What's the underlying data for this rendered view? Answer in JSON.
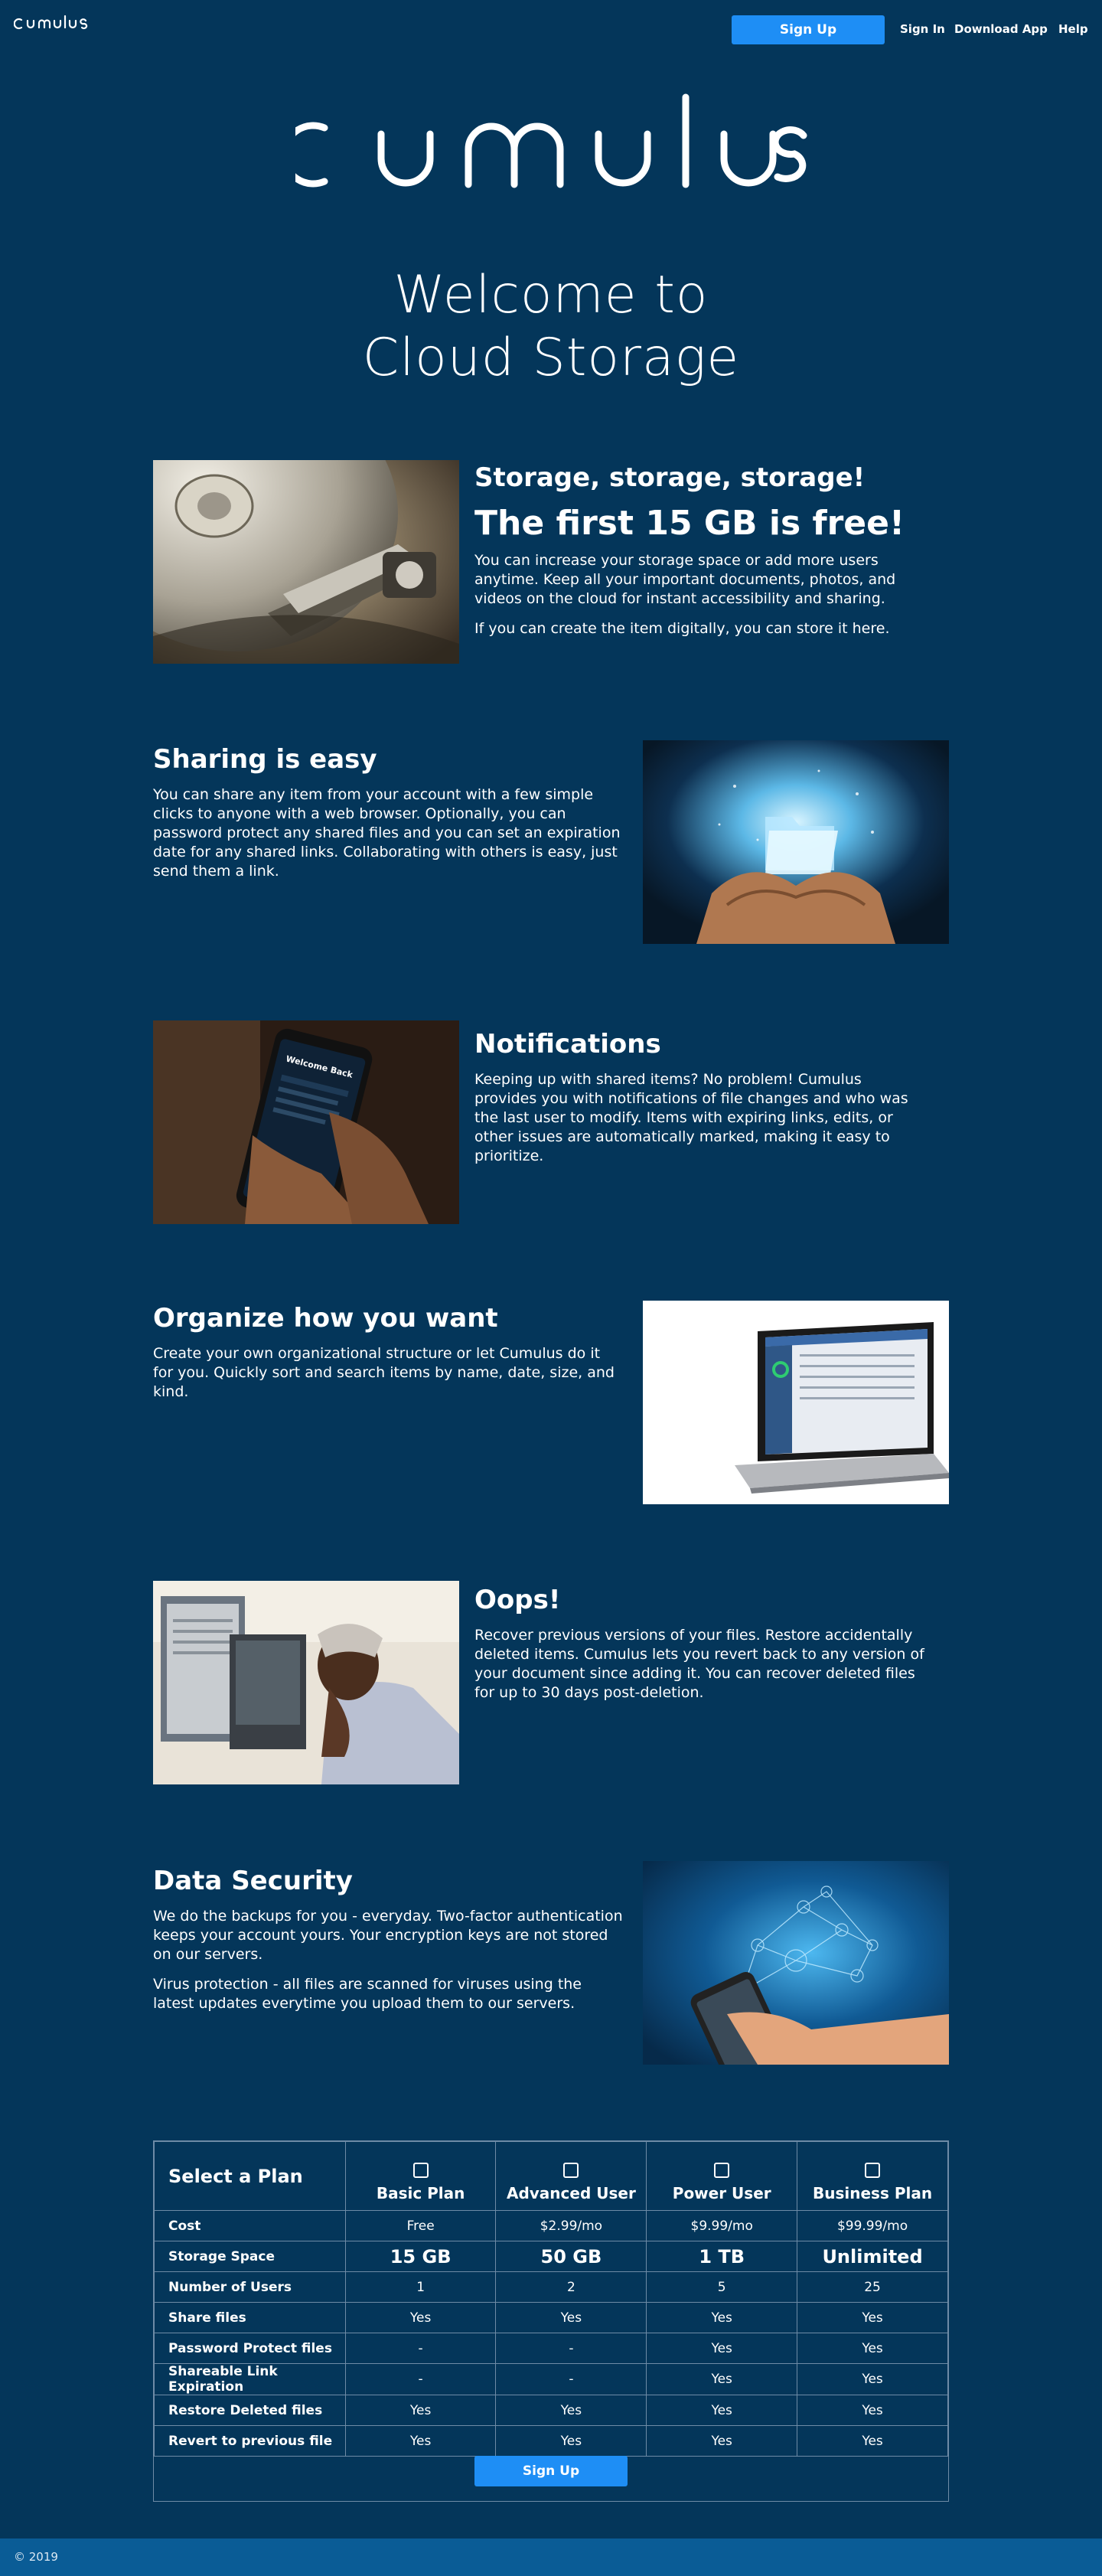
{
  "nav": {
    "logo_text": "cumulus",
    "signup_label": "Sign Up",
    "links": [
      "Sign In",
      "Download App",
      "Help"
    ]
  },
  "hero": {
    "logo_text": "cumulus",
    "welcome_line1": "Welcome to",
    "welcome_line2": "Cloud Storage"
  },
  "features": [
    {
      "title": "Storage, storage, storage!",
      "headline": "The first 15 GB is free!",
      "paragraphs": [
        "You can increase your storage space or add more users anytime. Keep all your important documents, photos, and videos on the cloud for instant accessibility and sharing.",
        "If you can create the item digitally, you can store it here."
      ],
      "image": "hard-drive-photo"
    },
    {
      "title": "Sharing is easy",
      "paragraphs": [
        "You can share any item from your account with a few simple clicks to anyone with a web browser. Optionally, you can password protect any shared files and you can set an expiration date for any shared links. Collaborating with others is easy, just send them a link."
      ],
      "image": "glowing-folder-photo"
    },
    {
      "title": "Notifications",
      "paragraphs": [
        "Keeping up with shared items? No problem! Cumulus provides you with notifications of file changes and who was the last user to modify. Items with expiring links, edits, or other issues are automatically marked, making it easy to prioritize."
      ],
      "image": "phone-in-hand-photo",
      "phone_text": "Welcome Back"
    },
    {
      "title": "Organize how you want",
      "paragraphs": [
        "Create your own organizational structure or let Cumulus do it for you. Quickly sort and search items by name, date, size, and kind."
      ],
      "image": "laptop-photo"
    },
    {
      "title": "Oops!",
      "paragraphs": [
        "Recover previous versions of your files. Restore accidentally deleted items. Cumulus lets you revert back to any version of your document since adding it. You can recover deleted files for up to 30 days post-deletion."
      ],
      "image": "frustrated-man-photo"
    },
    {
      "title": "Data Security",
      "paragraphs": [
        "We do the backups for you - everyday. Two-factor authentication keeps your account yours. Your encryption keys are not stored on our servers.",
        "Virus protection - all files are scanned for viruses using the latest updates everytime you upload them to our servers."
      ],
      "image": "network-hand-photo"
    }
  ],
  "plans": {
    "heading": "Select a Plan",
    "columns": [
      "Basic Plan",
      "Advanced User",
      "Power User",
      "Business Plan"
    ],
    "rows": [
      {
        "label": "Cost",
        "values": [
          "Free",
          "$2.99/mo",
          "$9.99/mo",
          "$99.99/mo"
        ],
        "big": false
      },
      {
        "label": "Storage Space",
        "values": [
          "15 GB",
          "50 GB",
          "1 TB",
          "Unlimited"
        ],
        "big": true
      },
      {
        "label": "Number of Users",
        "values": [
          "1",
          "2",
          "5",
          "25"
        ],
        "big": false
      },
      {
        "label": "Share files",
        "values": [
          "Yes",
          "Yes",
          "Yes",
          "Yes"
        ],
        "big": false
      },
      {
        "label": "Password Protect files",
        "values": [
          "-",
          "-",
          "Yes",
          "Yes"
        ],
        "big": false
      },
      {
        "label": "Shareable Link Expiration",
        "values": [
          "-",
          "-",
          "Yes",
          "Yes"
        ],
        "big": false
      },
      {
        "label": "Restore Deleted files",
        "values": [
          "Yes",
          "Yes",
          "Yes",
          "Yes"
        ],
        "big": false
      },
      {
        "label": "Revert to previous file",
        "values": [
          "Yes",
          "Yes",
          "Yes",
          "Yes"
        ],
        "big": false
      }
    ],
    "signup_label": "Sign Up"
  },
  "footer": {
    "copyright": "© 2019"
  },
  "colors": {
    "background": "#04365a",
    "accent": "#1e8ef5",
    "footer": "#0a5c96"
  }
}
